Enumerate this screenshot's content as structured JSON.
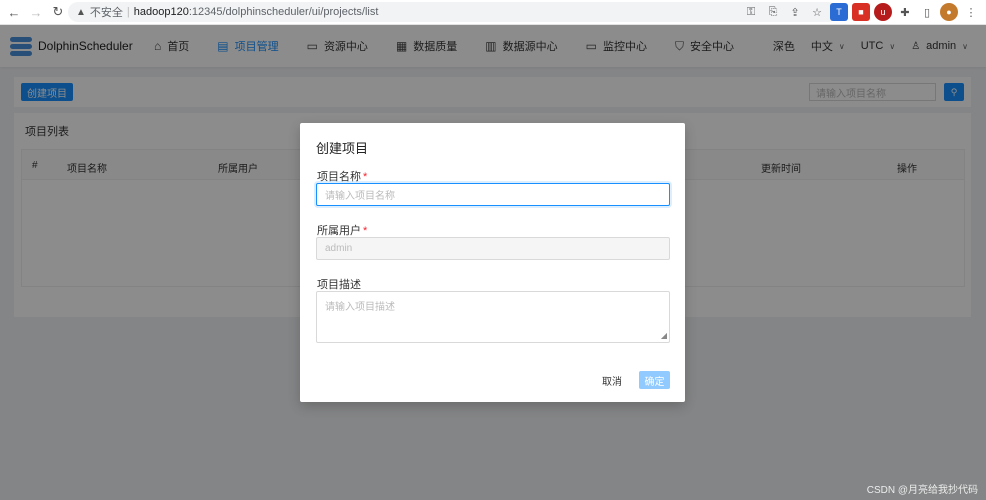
{
  "browser": {
    "insecure_label": "不安全",
    "url_host": "hadoop120",
    "url_path": ":12345/dolphinscheduler/ui/projects/list"
  },
  "app": {
    "name": "DolphinScheduler",
    "menu": [
      {
        "label": "首页",
        "icon": "home-icon",
        "glyph": "⌂"
      },
      {
        "label": "项目管理",
        "icon": "project-icon",
        "glyph": "▤",
        "active": true
      },
      {
        "label": "资源中心",
        "icon": "folder-icon",
        "glyph": "▭"
      },
      {
        "label": "数据质量",
        "icon": "data-quality-icon",
        "glyph": "▦"
      },
      {
        "label": "数据源中心",
        "icon": "datasource-icon",
        "glyph": "▥"
      },
      {
        "label": "监控中心",
        "icon": "monitor-icon",
        "glyph": "▭"
      },
      {
        "label": "安全中心",
        "icon": "shield-icon",
        "glyph": "⛉"
      }
    ],
    "theme_label": "深色",
    "language_label": "中文",
    "timezone_label": "UTC",
    "user_label": "admin"
  },
  "toolbar": {
    "create_label": "创建项目",
    "search_placeholder": "请输入项目名称"
  },
  "list": {
    "title": "项目列表",
    "columns": [
      "#",
      "项目名称",
      "所属用户",
      "更新时间",
      "操作"
    ]
  },
  "modal": {
    "title": "创建项目",
    "name_label": "项目名称",
    "name_placeholder": "请输入项目名称",
    "owner_label": "所属用户",
    "owner_value": "admin",
    "desc_label": "项目描述",
    "desc_placeholder": "请输入项目描述",
    "required_mark": "*",
    "cancel_label": "取消",
    "ok_label": "确定"
  },
  "watermark": "CSDN @月亮给我抄代码"
}
